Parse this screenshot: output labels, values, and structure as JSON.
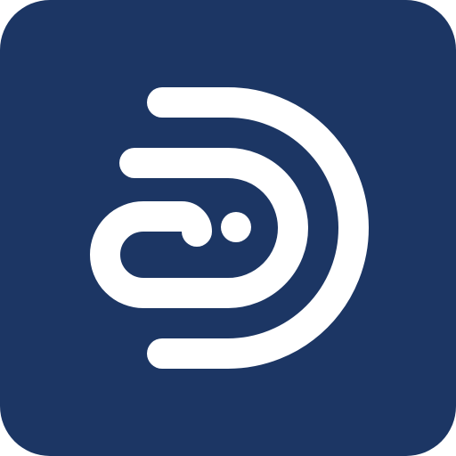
{
  "icon": {
    "name": "app-logo-icon",
    "background_color": "#1C3664",
    "glyph_color": "#FFFFFF"
  }
}
